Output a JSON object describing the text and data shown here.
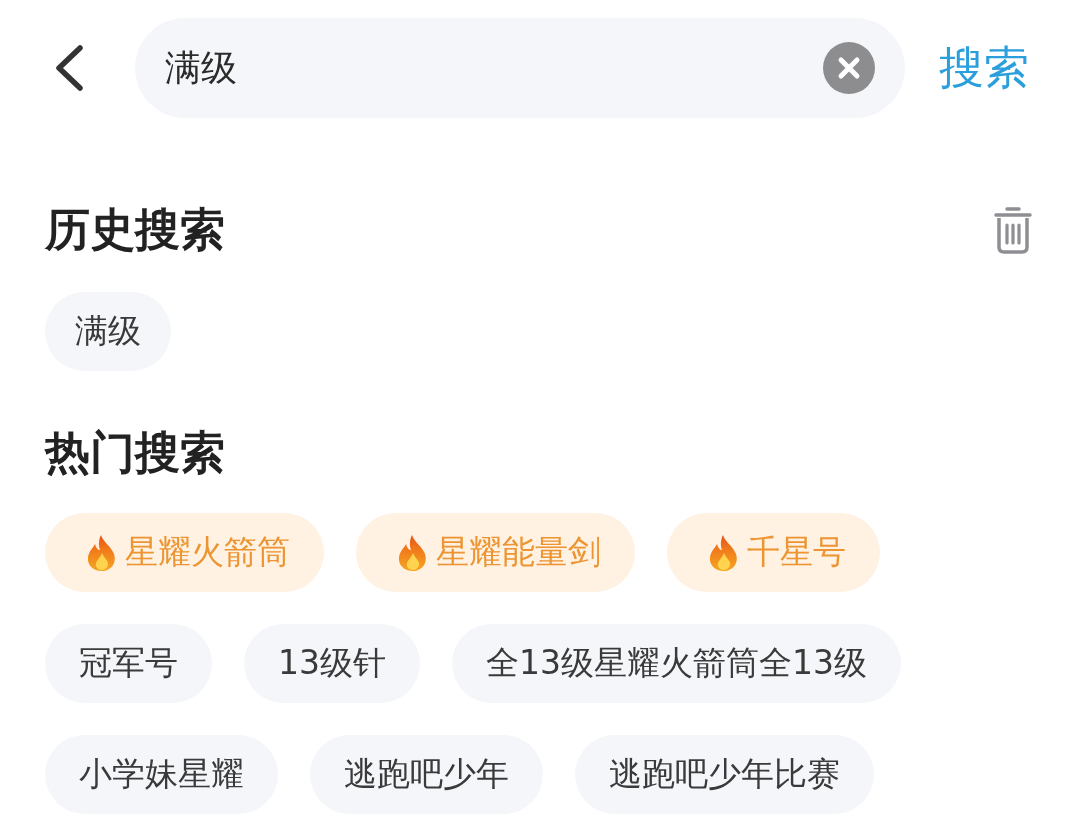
{
  "search_bar": {
    "value": "满级",
    "action": "搜索"
  },
  "history": {
    "title": "历史搜索",
    "items": [
      "满级"
    ]
  },
  "hot": {
    "title": "热门搜索",
    "items": [
      {
        "label": "星耀火箭筒",
        "kind": "hot"
      },
      {
        "label": "星耀能量剑",
        "kind": "hot"
      },
      {
        "label": "千星号",
        "kind": "hot"
      },
      {
        "label": "冠军号",
        "kind": "plain"
      },
      {
        "label": "13级针",
        "kind": "plain"
      },
      {
        "label": "全13级星耀火箭筒全13级",
        "kind": "plain"
      },
      {
        "label": "小学妹星耀",
        "kind": "plain"
      },
      {
        "label": "逃跑吧少年",
        "kind": "plain"
      },
      {
        "label": "逃跑吧少年比赛",
        "kind": "plain"
      }
    ]
  }
}
